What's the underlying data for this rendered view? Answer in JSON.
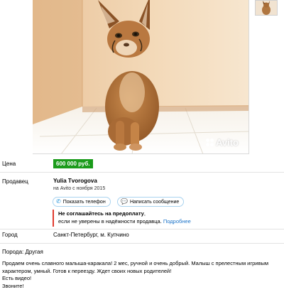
{
  "listing": {
    "photo_watermark": "Avito"
  },
  "price": {
    "label": "Цена",
    "value": "600 000 руб.",
    "badge_color": "#1a9b1a"
  },
  "seller": {
    "label": "Продавец",
    "name": "Yulia Tvorogova",
    "since": "на Avito с ноября 2015"
  },
  "actions": {
    "show_phone": {
      "label": "Показать телефон",
      "icon": "phone-icon"
    },
    "write_message": {
      "label": "Написать сообщение",
      "icon": "chat-icon"
    },
    "accent_color": "#1b8fd8"
  },
  "warning": {
    "title": "Не соглашайтесь на предоплату",
    "title_suffix": ",",
    "text": "если не уверены в надёжности продавца.",
    "link": "Подробнее",
    "border_color": "#e03a2f"
  },
  "city": {
    "label": "Город",
    "value": "Санкт-Петербург, м. Купчино"
  },
  "breed": "Порода: Другая",
  "description": [
    "Продаем очень славного малыша-каракала! 2 мес, ручной и очень добрый. Малыш с прелестным игривым характером, умный. Готов к переезду. Ждет своих новых родителей!",
    "Есть видео!",
    "Звоните!"
  ]
}
